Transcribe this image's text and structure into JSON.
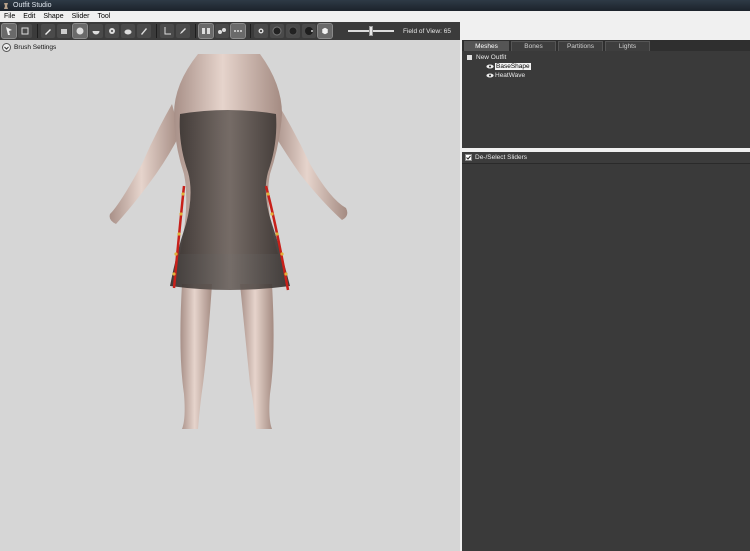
{
  "window": {
    "title": "Outfit Studio"
  },
  "menu": {
    "items": [
      "File",
      "Edit",
      "Shape",
      "Slider",
      "Tool"
    ]
  },
  "toolbar": {
    "field_of_view_label": "Field of View: 65",
    "fov_slider_value": 0.5,
    "tools": [
      "select-tool-icon",
      "transform-tool-icon",
      "brush-tool-icon",
      "eraser-tool-icon",
      "inflate-brush-icon",
      "deflate-brush-icon",
      "move-brush-icon",
      "smooth-brush-icon",
      "mask-brush-icon",
      "weight-brush-icon",
      "color-brush-icon",
      "axis-icon",
      "pen-icon",
      "mirror-icon",
      "connected-icon",
      "symmetry-icon",
      "vertex-dot-icon",
      "wireframe-sphere-icon",
      "solid-sphere-icon",
      "lighting-sphere-icon",
      "texture-cube-icon"
    ]
  },
  "viewport": {
    "brush_settings_label": "Brush Settings"
  },
  "panel": {
    "tabs": [
      "Meshes",
      "Bones",
      "Partitions",
      "Lights"
    ],
    "active_tab": "Meshes",
    "tree": {
      "root": "New Outfit",
      "children": [
        "BaseShape",
        "HeatWave"
      ],
      "selected": "BaseShape"
    }
  },
  "sliders": {
    "header_label": "De-/Select Sliders",
    "checked": true
  },
  "colors": {
    "viewport_bg": "#d6d6d6",
    "panel_bg": "#3a3a3a",
    "toolbar_bg": "#3b3b3b",
    "skin": "#d8c3bb",
    "outfit": "#4a4340",
    "lacing": "#c8201a"
  }
}
